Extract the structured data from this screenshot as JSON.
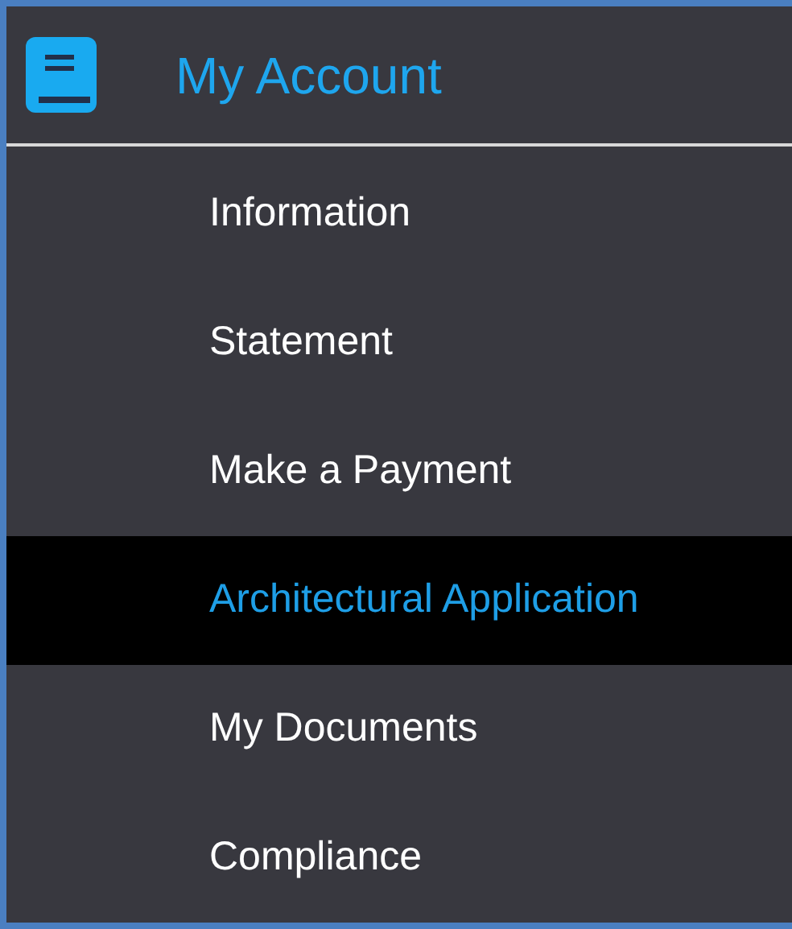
{
  "header": {
    "title": "My Account"
  },
  "menu": [
    {
      "label": "Information",
      "selected": false
    },
    {
      "label": "Statement",
      "selected": false
    },
    {
      "label": "Make a Payment",
      "selected": false
    },
    {
      "label": "Architectural Application",
      "selected": true
    },
    {
      "label": "My Documents",
      "selected": false
    },
    {
      "label": "Compliance",
      "selected": false
    }
  ]
}
